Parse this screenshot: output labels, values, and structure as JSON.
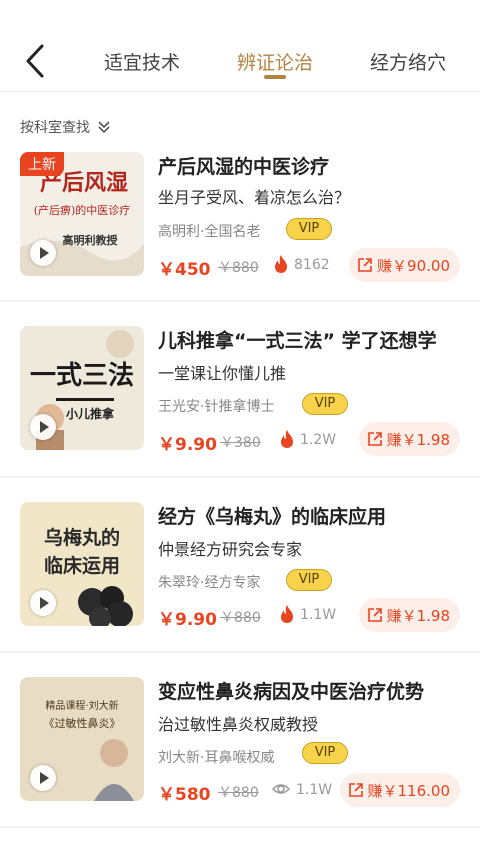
{
  "header": {
    "tabs": [
      {
        "label": "适宜技术",
        "active": false
      },
      {
        "label": "辨证论治",
        "active": true
      },
      {
        "label": "经方络穴",
        "active": false
      }
    ]
  },
  "filter": {
    "label": "按科室查找"
  },
  "colors": {
    "accent": "#b38540",
    "price": "#e8441f",
    "vip_bg": "#f7d24b",
    "earn_bg": "#fcefea"
  },
  "courses": [
    {
      "new_tag": "上新",
      "thumb_title": "产后风湿",
      "thumb_sub": "(产后痹)的中医诊疗",
      "thumb_teacher": "高明利教授",
      "title": "产后风湿的中医诊疗",
      "subtitle": "坐月子受风、着凉怎么治？",
      "author": "高明利·全国名老",
      "vip": "VIP",
      "price": "￥450",
      "original_price": "￥880",
      "stat_icon": "fire-icon",
      "stat": "8162",
      "earn": "赚￥90.00"
    },
    {
      "thumb_title": "一式三法",
      "thumb_sub": "小儿推拿",
      "title": "儿科推拿“一式三法” 学了还想学",
      "subtitle": "一堂课让你懂儿推",
      "author": "王光安·针推拿博士",
      "vip": "VIP",
      "price": "￥9.90",
      "original_price": "￥380",
      "stat_icon": "fire-icon",
      "stat": "1.2W",
      "earn": "赚￥1.98"
    },
    {
      "thumb_title": "乌梅丸的",
      "thumb_sub": "临床运用",
      "title": "经方《乌梅丸》的临床应用",
      "subtitle": "仲景经方研究会专家",
      "author": "朱翠玲·经方专家",
      "vip": "VIP",
      "price": "￥9.90",
      "original_price": "￥880",
      "stat_icon": "fire-icon",
      "stat": "1.1W",
      "earn": "赚￥1.98"
    },
    {
      "thumb_title": "精品课程·刘大新",
      "thumb_sub": "《过敏性鼻炎》",
      "title": "变应性鼻炎病因及中医治疗优势",
      "subtitle": "治过敏性鼻炎权威教授",
      "author": "刘大新·耳鼻喉权威",
      "vip": "VIP",
      "price": "￥580",
      "original_price": "￥880",
      "stat_icon": "eye-icon",
      "stat": "1.1W",
      "earn": "赚￥116.00"
    }
  ]
}
